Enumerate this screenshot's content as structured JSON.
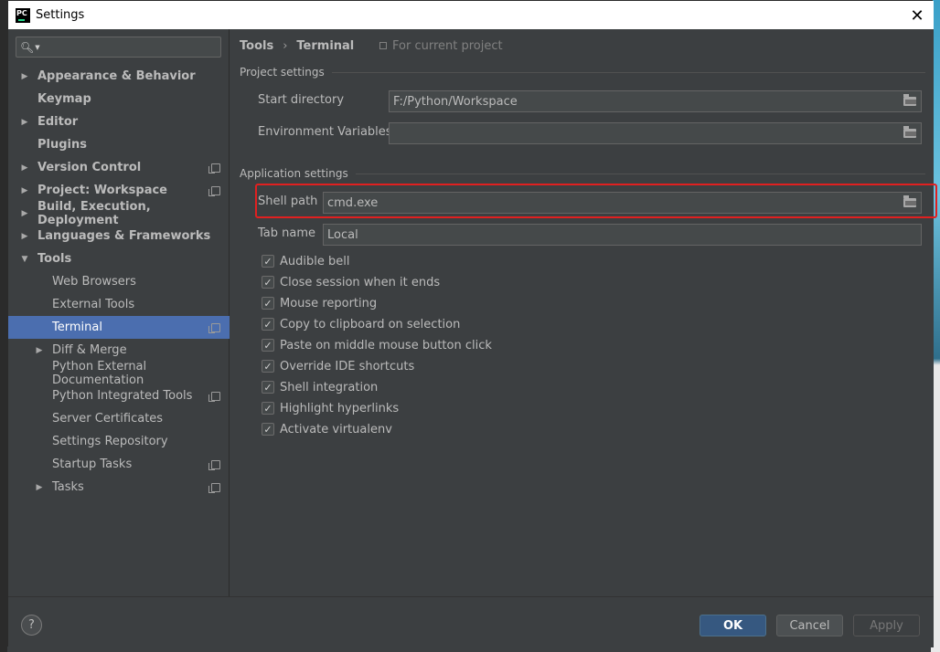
{
  "window": {
    "title": "Settings",
    "logo": "PC"
  },
  "search": {
    "placeholder": ""
  },
  "tree": [
    {
      "label": "Appearance & Behavior",
      "level": 0,
      "arrow": "right",
      "bold": true,
      "copy": false,
      "selected": false
    },
    {
      "label": "Keymap",
      "level": 0,
      "arrow": "",
      "bold": true,
      "copy": false,
      "selected": false
    },
    {
      "label": "Editor",
      "level": 0,
      "arrow": "right",
      "bold": true,
      "copy": false,
      "selected": false
    },
    {
      "label": "Plugins",
      "level": 0,
      "arrow": "",
      "bold": true,
      "copy": false,
      "selected": false
    },
    {
      "label": "Version Control",
      "level": 0,
      "arrow": "right",
      "bold": true,
      "copy": true,
      "selected": false
    },
    {
      "label": "Project: Workspace",
      "level": 0,
      "arrow": "right",
      "bold": true,
      "copy": true,
      "selected": false
    },
    {
      "label": "Build, Execution, Deployment",
      "level": 0,
      "arrow": "right",
      "bold": true,
      "copy": false,
      "selected": false
    },
    {
      "label": "Languages & Frameworks",
      "level": 0,
      "arrow": "right",
      "bold": true,
      "copy": false,
      "selected": false
    },
    {
      "label": "Tools",
      "level": 0,
      "arrow": "down",
      "bold": true,
      "copy": false,
      "selected": false
    },
    {
      "label": "Web Browsers",
      "level": 1,
      "arrow": "",
      "bold": false,
      "copy": false,
      "selected": false
    },
    {
      "label": "External Tools",
      "level": 1,
      "arrow": "",
      "bold": false,
      "copy": false,
      "selected": false
    },
    {
      "label": "Terminal",
      "level": 1,
      "arrow": "",
      "bold": false,
      "copy": true,
      "selected": true
    },
    {
      "label": "Diff & Merge",
      "level": 1,
      "arrow": "right",
      "bold": false,
      "copy": false,
      "selected": false
    },
    {
      "label": "Python External Documentation",
      "level": 1,
      "arrow": "",
      "bold": false,
      "copy": false,
      "selected": false
    },
    {
      "label": "Python Integrated Tools",
      "level": 1,
      "arrow": "",
      "bold": false,
      "copy": true,
      "selected": false
    },
    {
      "label": "Server Certificates",
      "level": 1,
      "arrow": "",
      "bold": false,
      "copy": false,
      "selected": false
    },
    {
      "label": "Settings Repository",
      "level": 1,
      "arrow": "",
      "bold": false,
      "copy": false,
      "selected": false
    },
    {
      "label": "Startup Tasks",
      "level": 1,
      "arrow": "",
      "bold": false,
      "copy": true,
      "selected": false
    },
    {
      "label": "Tasks",
      "level": 1,
      "arrow": "right",
      "bold": false,
      "copy": true,
      "selected": false
    }
  ],
  "breadcrumb": {
    "parent": "Tools",
    "separator": "›",
    "current": "Terminal"
  },
  "scope_note": "For current project",
  "project_settings": {
    "title": "Project settings",
    "start_directory_label": "Start directory",
    "start_directory_value": "F:/Python/Workspace",
    "env_vars_label": "Environment Variables",
    "env_vars_value": ""
  },
  "application_settings": {
    "title": "Application settings",
    "shell_path_label": "Shell path",
    "shell_path_value": "cmd.exe",
    "tab_name_label": "Tab name",
    "tab_name_value": "Local"
  },
  "checkboxes": [
    {
      "label": "Audible bell",
      "checked": true
    },
    {
      "label": "Close session when it ends",
      "checked": true
    },
    {
      "label": "Mouse reporting",
      "checked": true
    },
    {
      "label": "Copy to clipboard on selection",
      "checked": true
    },
    {
      "label": "Paste on middle mouse button click",
      "checked": true
    },
    {
      "label": "Override IDE shortcuts",
      "checked": true
    },
    {
      "label": "Shell integration",
      "checked": true
    },
    {
      "label": "Highlight hyperlinks",
      "checked": true
    },
    {
      "label": "Activate virtualenv",
      "checked": true
    }
  ],
  "buttons": {
    "help": "?",
    "ok": "OK",
    "cancel": "Cancel",
    "apply": "Apply"
  },
  "colors": {
    "selection": "#4b6eaf",
    "highlight_border": "#e02020",
    "ok_button": "#365880"
  }
}
